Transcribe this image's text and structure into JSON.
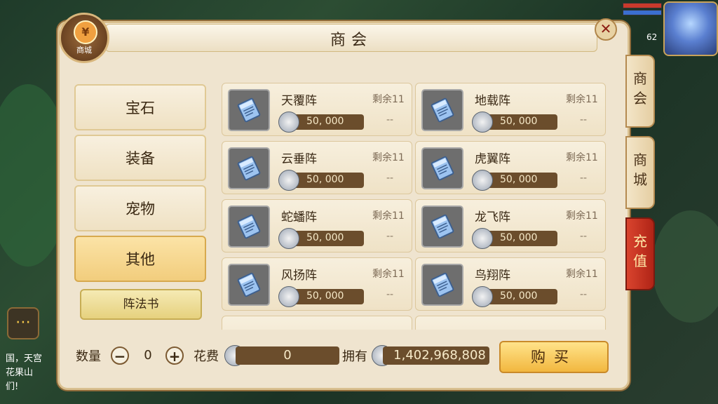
{
  "panel": {
    "title": "商会",
    "logo_label": "商城",
    "logo_symbol": "¥"
  },
  "side_tabs": [
    "商会",
    "商城",
    "充值"
  ],
  "categories": [
    "宝石",
    "装备",
    "宠物",
    "其他"
  ],
  "active_category": "其他",
  "subcategory": "阵法书",
  "items": [
    {
      "name": "天覆阵",
      "remain": "剩余11",
      "price": "50, 000",
      "dash": "--"
    },
    {
      "name": "地载阵",
      "remain": "剩余11",
      "price": "50, 000",
      "dash": "--"
    },
    {
      "name": "云垂阵",
      "remain": "剩余11",
      "price": "50, 000",
      "dash": "--"
    },
    {
      "name": "虎翼阵",
      "remain": "剩余11",
      "price": "50, 000",
      "dash": "--"
    },
    {
      "name": "蛇蟠阵",
      "remain": "剩余11",
      "price": "50, 000",
      "dash": "--"
    },
    {
      "name": "龙飞阵",
      "remain": "剩余11",
      "price": "50, 000",
      "dash": "--"
    },
    {
      "name": "风扬阵",
      "remain": "剩余11",
      "price": "50, 000",
      "dash": "--"
    },
    {
      "name": "鸟翔阵",
      "remain": "剩余11",
      "price": "50, 000",
      "dash": "--"
    }
  ],
  "bottom": {
    "quantity_label": "数量",
    "quantity_value": "0",
    "cost_label": "花费",
    "cost_value": "0",
    "owned_label": "拥有",
    "owned_value": "1,402,968,808",
    "buy_label": "购买"
  },
  "hud": {
    "level": "62",
    "chat_lines": [
      "国，天宫",
      "花果山",
      "们!"
    ]
  },
  "colors": {
    "panel_bg": "#efe4cf",
    "active_category": "#f2cd7d",
    "price_bar": "#6b4d2c",
    "recharge_tab": "#c0301c"
  },
  "icons": {
    "item": "formation-book-icon",
    "currency": "silver-coin-icon",
    "close": "close-icon",
    "chat": "chat-bubble-icon"
  }
}
